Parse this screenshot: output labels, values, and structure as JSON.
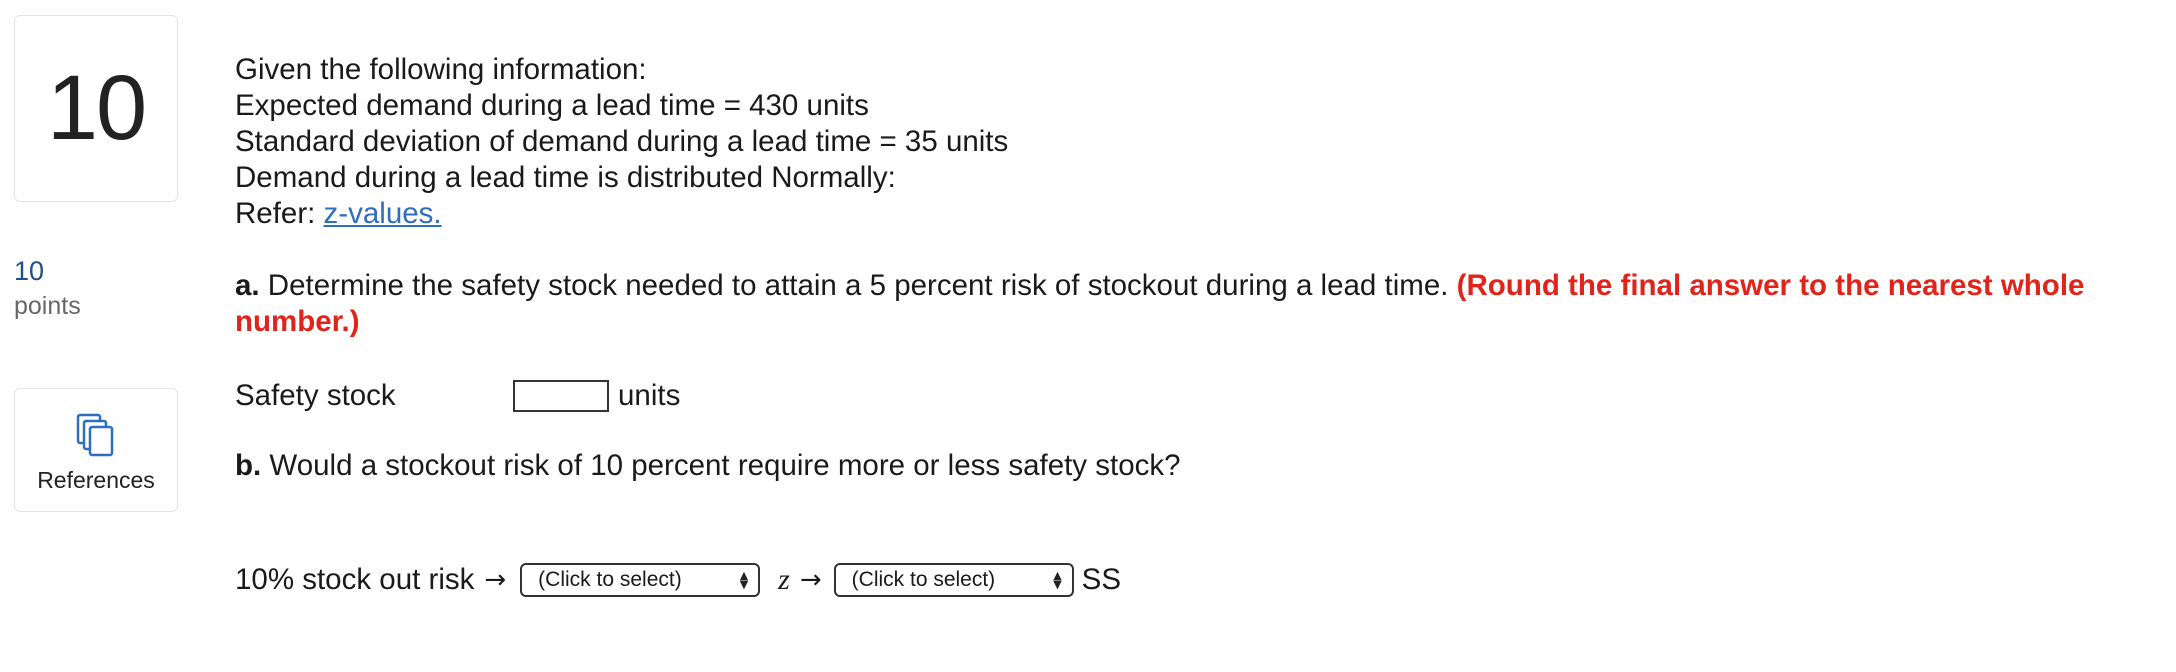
{
  "question": {
    "number": "10",
    "points_value": "10",
    "points_label": "points",
    "references_label": "References"
  },
  "problem": {
    "lines": [
      "Given the following information:",
      "Expected demand during a lead time = 430 units",
      "Standard deviation of demand during a lead time = 35 units",
      "Demand during a lead time is distributed Normally:"
    ],
    "refer_prefix": "Refer: ",
    "refer_link": "z-values."
  },
  "part_a": {
    "label": "a.",
    "text": " Determine the safety stock needed to attain a 5 percent risk of stockout during a lead time. ",
    "note": "(Round the final answer to the nearest whole number.)"
  },
  "safety_stock": {
    "label": "Safety stock",
    "value": "",
    "unit": "units"
  },
  "part_b": {
    "label": "b.",
    "text": " Would a stockout risk of 10 percent require more or less safety stock?"
  },
  "risk_row": {
    "prefix": "10% stock out risk",
    "arrow": "→",
    "select_1": "(Click to select)",
    "z_label": "z",
    "select_2": "(Click to select)",
    "suffix": "SS"
  },
  "colors": {
    "link": "#2f6dbf",
    "note_red": "#e2231a",
    "points_blue": "#1f4e8c",
    "icon_blue": "#2f6dbf"
  },
  "icons": {
    "references": "copy-documents-icon",
    "select": "up-down-chevron-icon"
  }
}
